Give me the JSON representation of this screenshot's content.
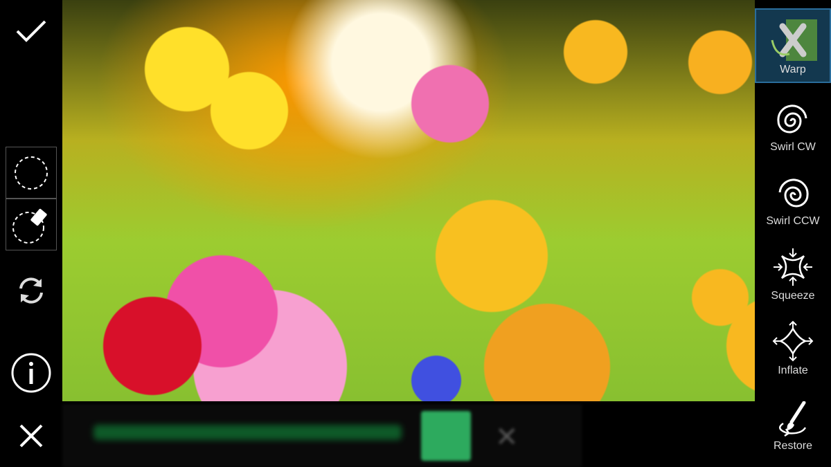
{
  "left_toolbar": {
    "items": [
      {
        "name": "confirm",
        "icon": "checkmark-icon"
      },
      {
        "name": "lasso-select",
        "icon": "dashed-circle-icon"
      },
      {
        "name": "lasso-erase",
        "icon": "dashed-circle-eraser-icon"
      },
      {
        "name": "reset",
        "icon": "refresh-icon"
      },
      {
        "name": "info",
        "icon": "info-icon"
      },
      {
        "name": "cancel",
        "icon": "close-icon"
      }
    ]
  },
  "right_toolbar": {
    "active": "Warp",
    "accent": "#2a6d9c",
    "tools": [
      {
        "label": "Warp",
        "icon": "warp-icon"
      },
      {
        "label": "Swirl CW",
        "icon": "swirl-cw-icon"
      },
      {
        "label": "Swirl CCW",
        "icon": "swirl-ccw-icon"
      },
      {
        "label": "Squeeze",
        "icon": "squeeze-icon"
      },
      {
        "label": "Inflate",
        "icon": "inflate-icon"
      },
      {
        "label": "Restore",
        "icon": "brush-restore-icon"
      }
    ]
  },
  "ad_banner": {
    "button_color": "#2daa5e"
  }
}
